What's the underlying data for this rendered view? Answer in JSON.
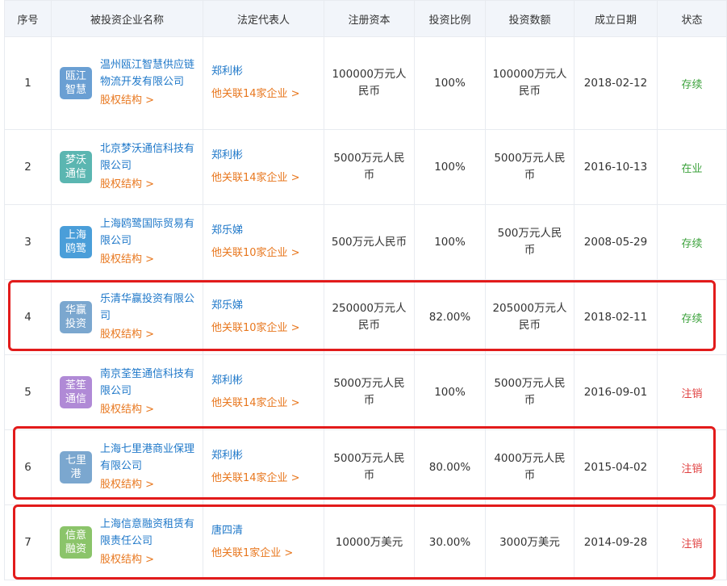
{
  "headers": [
    "序号",
    "被投资企业名称",
    "法定代表人",
    "注册资本",
    "投资比例",
    "投资数额",
    "成立日期",
    "状态"
  ],
  "equity_label": "股权结构 >",
  "rows": [
    {
      "idx": "1",
      "logo1": "瓯江",
      "logo2": "智慧",
      "logo_color": "#6a9fd3",
      "name": "温州瓯江智慧供应链物流开发有限公司",
      "rep": "郑利彬",
      "rel": "他关联14家企业 >",
      "capital": "100000万元人民币",
      "ratio": "100%",
      "amount": "100000万元人民币",
      "date": "2018-02-12",
      "status": "存续",
      "status_color": "green"
    },
    {
      "idx": "2",
      "logo1": "梦沃",
      "logo2": "通信",
      "logo_color": "#5bb6b1",
      "name": "北京梦沃通信科技有限公司",
      "rep": "郑利彬",
      "rel": "他关联14家企业 >",
      "capital": "5000万元人民币",
      "ratio": "100%",
      "amount": "5000万元人民币",
      "date": "2016-10-13",
      "status": "在业",
      "status_color": "green"
    },
    {
      "idx": "3",
      "logo1": "上海",
      "logo2": "鸥鹭",
      "logo_color": "#4a9ed9",
      "name": "上海鸥鹭国际贸易有限公司",
      "rep": "郑乐娣",
      "rel": "他关联10家企业 >",
      "capital": "500万元人民币",
      "ratio": "100%",
      "amount": "500万元人民币",
      "date": "2008-05-29",
      "status": "存续",
      "status_color": "green"
    },
    {
      "idx": "4",
      "logo1": "华赢",
      "logo2": "投资",
      "logo_color": "#7ba7cf",
      "name": "乐清华赢投资有限公司",
      "rep": "郑乐娣",
      "rel": "他关联10家企业 >",
      "capital": "250000万元人民币",
      "ratio": "82.00%",
      "amount": "205000万元人民币",
      "date": "2018-02-11",
      "status": "存续",
      "status_color": "green"
    },
    {
      "idx": "5",
      "logo1": "荃笙",
      "logo2": "通信",
      "logo_color": "#b08ad6",
      "name": "南京荃笙通信科技有限公司",
      "rep": "郑利彬",
      "rel": "他关联14家企业 >",
      "capital": "5000万元人民币",
      "ratio": "100%",
      "amount": "5000万元人民币",
      "date": "2016-09-01",
      "status": "注销",
      "status_color": "red"
    },
    {
      "idx": "6",
      "logo1": "七里",
      "logo2": "港",
      "logo_color": "#7ba7cf",
      "name": "上海七里港商业保理有限公司",
      "rep": "郑利彬",
      "rel": "他关联14家企业 >",
      "capital": "5000万元人民币",
      "ratio": "80.00%",
      "amount": "4000万元人民币",
      "date": "2015-04-02",
      "status": "注销",
      "status_color": "red"
    },
    {
      "idx": "7",
      "logo1": "信意",
      "logo2": "融资",
      "logo_color": "#8bc46a",
      "name": "上海信意融资租赁有限责任公司",
      "rep": "唐四清",
      "rel": "他关联1家企业 >",
      "capital": "10000万美元",
      "ratio": "30.00%",
      "amount": "3000万美元",
      "date": "2014-09-28",
      "status": "注销",
      "status_color": "red"
    }
  ]
}
